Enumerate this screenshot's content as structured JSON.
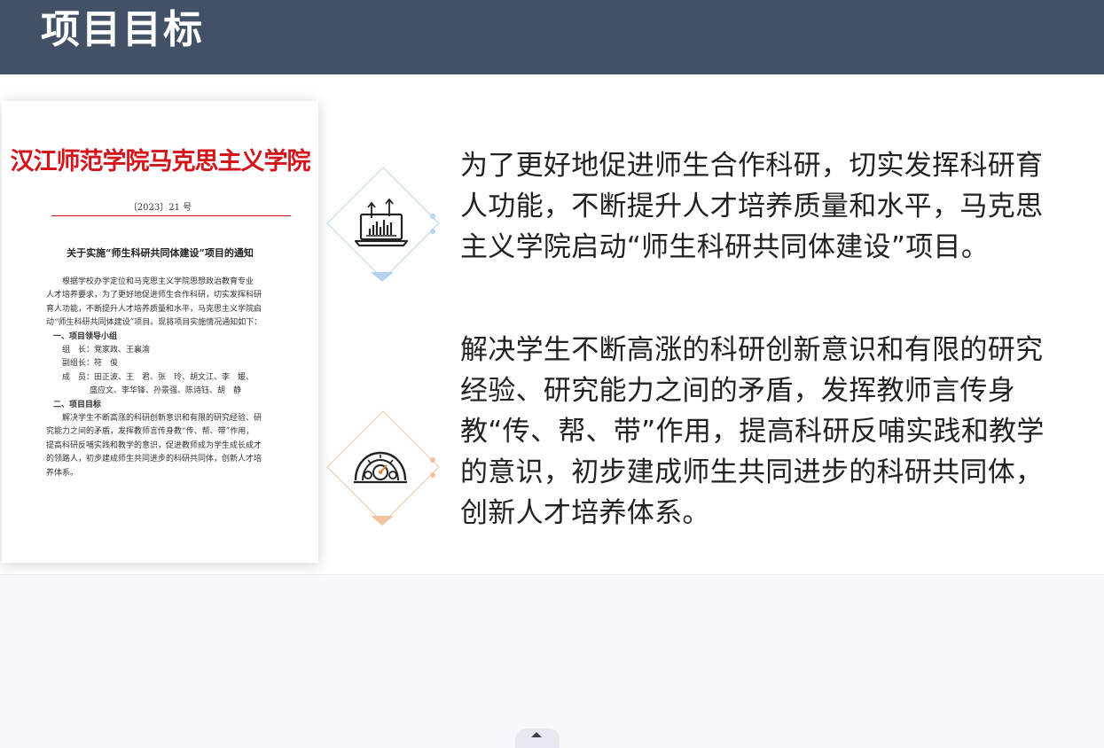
{
  "header": {
    "title": "项目目标"
  },
  "document": {
    "org_name": "汉江师范学院马克思主义学院",
    "doc_number": "〔2023〕21 号",
    "title": "关于实施“师生科研共同体建设”项目的通知",
    "intro_lines": [
      "根据学校办学定位和马克思主义学院思想政治教育专业",
      "人才培养要求，为了更好地促进师生合作科研，切实发挥科研",
      "育人功能，不断提升人才培养质量和水平，马克思主义学院启",
      "动“师生科研共同体建设”项目。现将项目实施情况通知如下："
    ],
    "section1_title": "一、项目领导小组",
    "leader": "组　长：党家政、王襄渝",
    "vice_leader": "副组长：符　俊",
    "members_1": "成　员：田正波、王　君、张　玲、胡文江、李　媛、",
    "members_2": "盛应文、李华锋、孙景强、陈诗钰、胡　静",
    "section2_title": "二、项目目标",
    "goal_lines": [
      "解决学生不断高涨的科研创新意识和有限的研究经验、研",
      "究能力之间的矛盾，发挥教师言传身教“传、帮、带”作用，",
      "提高科研反哺实践和教学的意识，促进教师成为学生成长成才",
      "的领路人，初步建成师生共同进步的科研共同体，创新人才培",
      "养体系。"
    ]
  },
  "goals": [
    {
      "icon": "laptop-chart-icon",
      "text": "为了更好地促进师生合作科研，切实发挥科研育人功能，不断提升人才培养质量和水平，马克思主义学院启动“师生科研共同体建设”项目。"
    },
    {
      "icon": "speedometer-icon",
      "text": "解决学生不断高涨的科研创新意识和有限的研究经验、研究能力之间的矛盾，发挥教师言传身教“传、帮、带”作用，提高科研反哺实践和教学的意识，初步建成师生共同进步的科研共同体，创新人才培养体系。"
    }
  ],
  "colors": {
    "header_bg": "#435166",
    "accent_blue": "#b7d2ec",
    "accent_peach": "#f2c3a1",
    "doc_red": "#d4141b"
  }
}
